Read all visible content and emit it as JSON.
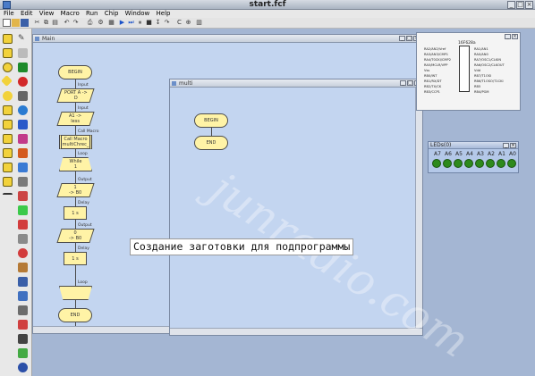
{
  "window": {
    "title": "start.fcf"
  },
  "menu": [
    "File",
    "Edit",
    "View",
    "Macro",
    "Run",
    "Chip",
    "Window",
    "Help"
  ],
  "main_window": {
    "title": "Main",
    "flow": {
      "begin": "BEGIN",
      "input_label": "Input",
      "input_text": "PORT A ->\nD",
      "output_label": "Input",
      "output_text": "A1 ->\nless",
      "call_label": "Call Macro",
      "call_text": "Call Macro\nmultiChrec_",
      "loop_label": "Loop",
      "while_text": "While\n1",
      "out1_label": "Output",
      "out1_text": "1\n-> B0",
      "delay1_label": "Delay",
      "delay1_text": "1 s",
      "out2_label": "Output",
      "out2_text": "0\n-> B0",
      "delay2_label": "Delay",
      "delay2_text": "1 s",
      "loop_end_label": "Loop",
      "end": "END"
    }
  },
  "sub_window": {
    "title": "multi",
    "begin": "BEGIN",
    "end": "END"
  },
  "chip_window": {
    "title": "16F628a",
    "left_pins": [
      "RA2/AN2/Vref",
      "RA3/AN3/CMP1",
      "RA4/T0CKI/CMP2",
      "RA5/MCLR/VPP",
      "Vss",
      "RB0/INT",
      "RB1/RX/DT",
      "RB2/TX/CK",
      "RB3/CCP1"
    ],
    "right_pins": [
      "RA1/AN1",
      "RA0/AN0",
      "RA7/OSC1/CLKIN",
      "RA6/OSC2/CLKOUT",
      "Vdd",
      "RB7/T1OSI",
      "RB6/T1OSO/T1CKI",
      "RB5",
      "RB4/PGM"
    ]
  },
  "led_panel": {
    "title": "LEDs(0)",
    "labels": [
      "A7",
      "A6",
      "A5",
      "A4",
      "A3",
      "A2",
      "A1",
      "A0"
    ],
    "led_color": "#2d8a1c"
  },
  "watermark": "junradio.com",
  "caption": "Создание заготовки для подпрограммы"
}
